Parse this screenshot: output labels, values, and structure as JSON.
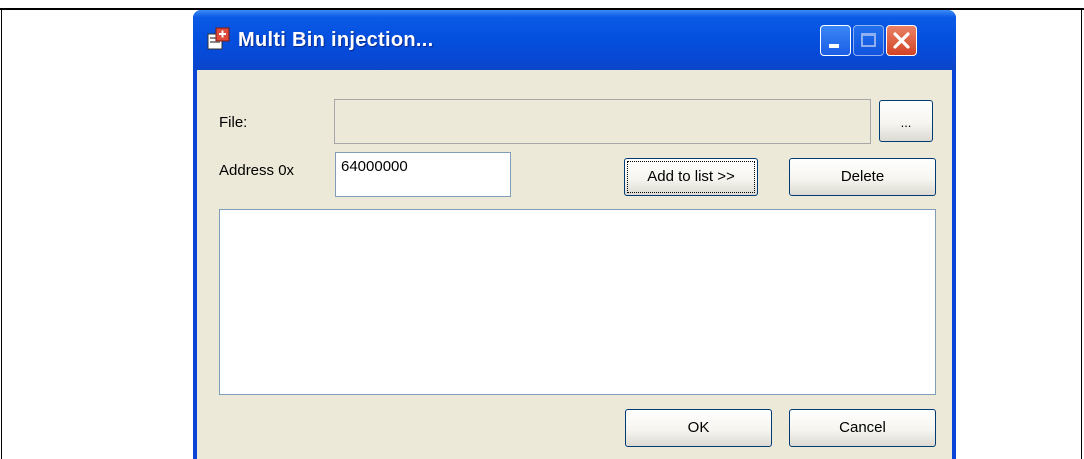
{
  "window": {
    "title": "Multi Bin injection...",
    "icon": "multi-bin-app-icon"
  },
  "form": {
    "file_label": "File:",
    "file_value": "",
    "browse_label": "...",
    "address_label": "Address 0x",
    "address_value": "64000000",
    "add_label": "Add to list >>",
    "delete_label": "Delete"
  },
  "list": {
    "items": []
  },
  "footer": {
    "ok_label": "OK",
    "cancel_label": "Cancel"
  },
  "colors": {
    "titlebar": "#0450df",
    "client": "#ece9d8",
    "close_button": "#d34326"
  }
}
